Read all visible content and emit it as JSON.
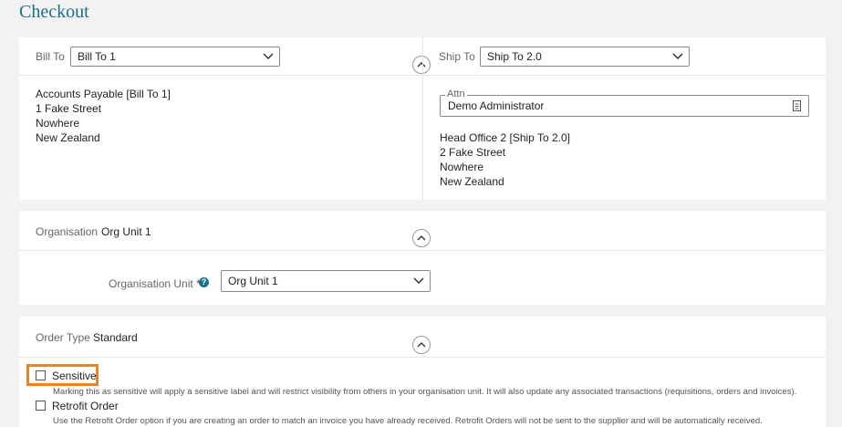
{
  "page": {
    "title": "Checkout"
  },
  "bill_to": {
    "label": "Bill To",
    "selected": "Bill To 1",
    "address": [
      "Accounts Payable [Bill To 1]",
      "1 Fake Street",
      "Nowhere",
      "New Zealand"
    ]
  },
  "ship_to": {
    "label": "Ship To",
    "selected": "Ship To 2.0",
    "attn_label": "Attn",
    "attn_value": "Demo Administrator",
    "address": [
      "Head Office 2 [Ship To 2.0]",
      "2 Fake Street",
      "Nowhere",
      "New Zealand"
    ]
  },
  "organisation": {
    "label": "Organisation",
    "value": "Org Unit 1",
    "unit_label": "Organisation Unit",
    "required_mark": "*",
    "help_icon_text": "?",
    "unit_selected": "Org Unit 1"
  },
  "order_type": {
    "label": "Order Type",
    "value": "Standard",
    "sensitive_label": "Sensitive",
    "sensitive_help": "Marking this as sensitive will apply a sensitive label and will restrict visibility from others in your organisation unit. It will also update any associated transactions (requisitions, orders and invoices).",
    "retrofit_label": "Retrofit Order",
    "retrofit_help": "Use the Retrofit Order option if you are creating an order to match an invoice you have already received. Retrofit Orders will not be sent to the supplier and will be automatically received."
  },
  "icons": {
    "chevron_down": "chevron-down-icon",
    "chevron_up": "chevron-up-icon",
    "contact_card": "contact-card-icon",
    "help": "help-circle-icon"
  },
  "colors": {
    "title": "#1f6f8b",
    "required": "#c0392b",
    "help": "#1f6f8b",
    "highlight": "#e8832a"
  }
}
